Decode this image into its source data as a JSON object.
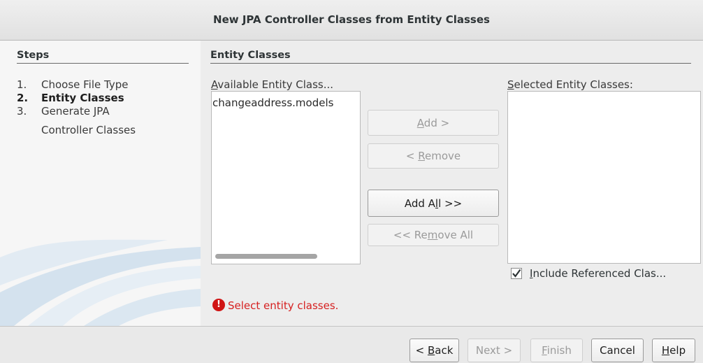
{
  "window": {
    "title": "New JPA Controller Classes from Entity Classes"
  },
  "steps": {
    "heading": "Steps",
    "items": [
      {
        "num": "1.",
        "label": "Choose File Type"
      },
      {
        "num": "2.",
        "label": "Entity Classes"
      },
      {
        "num": "3.",
        "label": "Generate JPA",
        "label_cont": "Controller Classes"
      }
    ]
  },
  "content": {
    "heading": "Entity Classes",
    "available": {
      "label_mnemonic": "A",
      "label_rest": "vailable Entity Class...",
      "items": [
        "changeaddress.models"
      ]
    },
    "selected": {
      "label_mnemonic": "S",
      "label_rest": "elected Entity Classes:",
      "items": []
    },
    "buttons": {
      "add": {
        "pre": "",
        "mn": "A",
        "post": "dd >"
      },
      "remove": {
        "pre": "< ",
        "mn": "R",
        "post": "emove"
      },
      "add_all": {
        "pre": "Add A",
        "mn": "l",
        "post": "l >>"
      },
      "remove_all": {
        "pre": "<< Re",
        "mn": "m",
        "post": "ove All"
      }
    },
    "include_referenced": {
      "pre": "",
      "mn": "I",
      "post": "nclude Referenced Clas...",
      "checked": true
    },
    "error": {
      "icon": "error-icon",
      "message": "Select entity classes."
    }
  },
  "footer": {
    "back": {
      "pre": "< ",
      "mn": "B",
      "post": "ack"
    },
    "next": {
      "label": "Next >"
    },
    "finish": {
      "pre": "",
      "mn": "F",
      "post": "inish"
    },
    "cancel": {
      "label": "Cancel"
    },
    "help": {
      "pre": "",
      "mn": "H",
      "post": "elp"
    }
  },
  "colors": {
    "error": "#d62020",
    "background": "#ededed"
  }
}
